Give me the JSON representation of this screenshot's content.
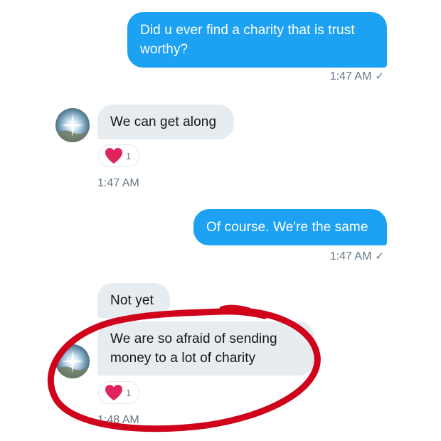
{
  "messages": [
    {
      "direction": "outgoing",
      "text": "Did u ever find a charity that is trust worthy?",
      "time": "1:47 AM"
    },
    {
      "direction": "incoming",
      "text": "We can get along",
      "reaction": {
        "icon": "heart-icon",
        "count": "1"
      },
      "time": "1:47 AM"
    },
    {
      "direction": "outgoing",
      "text": "Of course. We're the same",
      "time": "1:47 AM"
    },
    {
      "direction": "incoming",
      "text": "Not yet"
    },
    {
      "direction": "incoming",
      "text": "We are so afraid of sending money to a lot of charity",
      "reaction": {
        "icon": "heart-icon",
        "count": "1"
      },
      "time": "1:48 AM"
    }
  ],
  "colors": {
    "outgoing_bubble": "#1da1f2",
    "incoming_bubble": "#e6ecf0",
    "timestamp": "#657786",
    "heart": "#e0245e",
    "annotation": "#d0021b"
  }
}
